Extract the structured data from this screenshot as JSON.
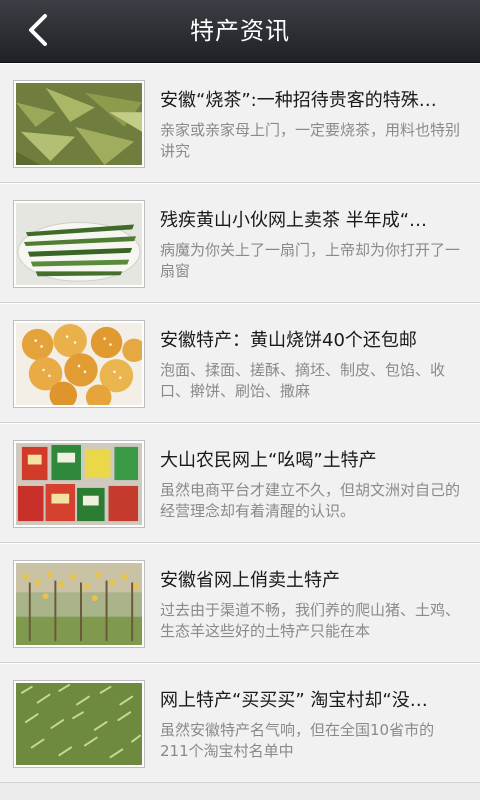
{
  "header": {
    "title": "特产资讯",
    "back_icon": "chevron-left-icon"
  },
  "colors": {
    "header_bg": "#2b2e33",
    "title_text": "#1a1a1a",
    "summary_text": "#8a8a8a",
    "list_bg": "#f1f1f1"
  },
  "articles": [
    {
      "title": "安徽“烧茶”:一种招待贵客的特殊…",
      "summary": "亲家或亲家母上门，一定要烧茶，用料也特别讲究",
      "image": "green-tea-leaves-photo"
    },
    {
      "title": "残疾黄山小伙网上卖茶 半年成“…",
      "summary": "病魔为你关上了一扇门，上帝却为你打开了一扇窗",
      "image": "flat-tea-on-plate-photo"
    },
    {
      "title": "安徽特产：黄山烧饼40个还包邮",
      "summary": "泡面、揉面、搓酥、摘坯、制皮、包馅、收口、擀饼、刷饴、撒麻",
      "image": "sesame-pastries-photo"
    },
    {
      "title": "大山农民网上“吆喝”土特产",
      "summary": "虽然电商平台才建立不久，但胡文洲对自己的经营理念却有着清醒的认识。",
      "image": "packaged-products-photo"
    },
    {
      "title": "安徽省网上俏卖土特产",
      "summary": "过去由于渠道不畅，我们养的爬山猪、土鸡、生态羊这些好的土特产只能在本",
      "image": "orchard-trees-photo"
    },
    {
      "title": "网上特产“买买买” 淘宝村却“没…",
      "summary": "虽然安徽特产名气响，但在全国10省市的211个淘宝村名单中",
      "image": "tea-sprouts-photo"
    }
  ]
}
